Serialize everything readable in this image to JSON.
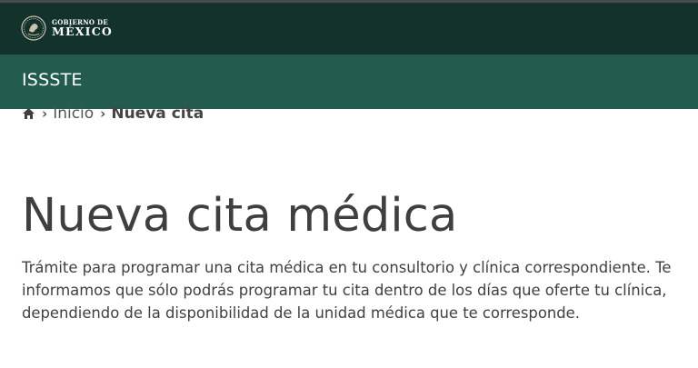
{
  "header": {
    "gov_line1": "GOBIERNO DE",
    "gov_line2": "MÉXICO",
    "seal_icon": "mexico-coat-of-arms-icon"
  },
  "subheader": {
    "title": "ISSSTE"
  },
  "breadcrumb": {
    "home_icon": "home-icon",
    "separator": "›",
    "items": [
      {
        "label": "Inicio"
      },
      {
        "label": "Nueva cita"
      }
    ]
  },
  "main": {
    "title": "Nueva cita médica",
    "description": "Trámite para programar una cita médica en tu consultorio y clínica correspondiente. Te informamos que sólo podrás programar tu cita dentro de los días que oferte tu clínica, dependiendo de la disponibilidad de la unidad médica que te corresponde."
  },
  "colors": {
    "topbar": "#13322b",
    "subbar": "#235b4e",
    "text": "#3f3f3f"
  }
}
